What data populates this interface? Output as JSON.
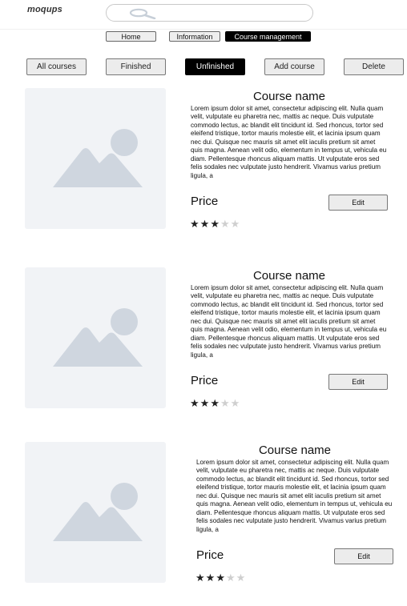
{
  "app": {
    "logo": "moqups"
  },
  "search": {
    "placeholder": ""
  },
  "nav": [
    {
      "label": "Home",
      "active": false
    },
    {
      "label": "Information",
      "active": false
    },
    {
      "label": "Course management",
      "active": true
    }
  ],
  "filters": [
    {
      "label": "All courses",
      "active": false
    },
    {
      "label": "Finished",
      "active": false
    },
    {
      "label": "Unfinished",
      "active": true
    },
    {
      "label": "Add course",
      "active": false
    },
    {
      "label": "Delete",
      "active": false
    }
  ],
  "courses": [
    {
      "name": "Course name",
      "description": "Lorem ipsum dolor sit amet, consectetur adipiscing elit. Nulla quam velit, vulputate eu pharetra nec, mattis ac neque. Duis vulputate commodo lectus, ac blandit elit tincidunt id. Sed rhoncus, tortor sed eleifend tristique, tortor mauris molestie elit, et lacinia ipsum quam nec dui. Quisque nec mauris sit amet elit iaculis pretium sit amet quis magna. Aenean velit odio, elementum in tempus ut, vehicula eu diam. Pellentesque rhoncus aliquam mattis. Ut vulputate eros sed felis sodales nec vulputate justo hendrerit. Vivamus varius pretium ligula, a",
      "price_label": "Price",
      "edit_label": "Edit",
      "rating": 3,
      "rating_max": 5
    },
    {
      "name": "Course name",
      "description": "Lorem ipsum dolor sit amet, consectetur adipiscing elit. Nulla quam velit, vulputate eu pharetra nec, mattis ac neque. Duis vulputate commodo lectus, ac blandit elit tincidunt id. Sed rhoncus, tortor sed eleifend tristique, tortor mauris molestie elit, et lacinia ipsum quam nec dui. Quisque nec mauris sit amet elit iaculis pretium sit amet quis magna. Aenean velit odio, elementum in tempus ut, vehicula eu diam. Pellentesque rhoncus aliquam mattis. Ut vulputate eros sed felis sodales nec vulputate justo hendrerit. Vivamus varius pretium ligula, a",
      "price_label": "Price",
      "edit_label": "Edit",
      "rating": 3,
      "rating_max": 5
    },
    {
      "name": "Course name",
      "description": "Lorem ipsum dolor sit amet, consectetur adipiscing elit. Nulla quam velit, vulputate eu pharetra nec, mattis ac neque. Duis vulputate commodo lectus, ac blandit elit tincidunt id. Sed rhoncus, tortor sed eleifend tristique, tortor mauris molestie elit, et lacinia ipsum quam nec dui. Quisque nec mauris sit amet elit iaculis pretium sit amet quis magna. Aenean velit odio, elementum in tempus ut, vehicula eu diam. Pellentesque rhoncus aliquam mattis. Ut vulputate eros sed felis sodales nec vulputate justo hendrerit. Vivamus varius pretium ligula, a",
      "price_label": "Price",
      "edit_label": "Edit",
      "rating": 3,
      "rating_max": 5
    }
  ],
  "icons": {
    "search": "search-icon",
    "image_placeholder": "image-placeholder-icon",
    "star": "star-icon"
  },
  "colors": {
    "active_bg": "#000000",
    "button_bg": "#ececec",
    "placeholder": "#cfd6df"
  }
}
